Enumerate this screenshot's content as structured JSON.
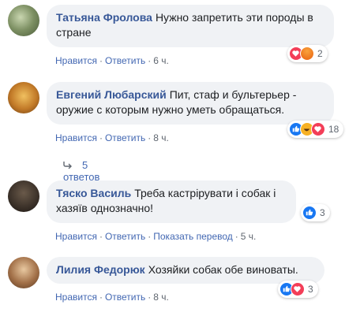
{
  "comments": [
    {
      "author": "Татьяна Фролова",
      "text": "Нужно запретить эти породы в стране",
      "actions": [
        "Нравится",
        "Ответить"
      ],
      "time": "6 ч.",
      "reactions": [
        "love-icon",
        "angry-icon"
      ],
      "reaction_count": "2"
    },
    {
      "author": "Евгений Любарский",
      "text": "Пит, стаф и бультерьер - оружие с которым нужно уметь обращаться.",
      "actions": [
        "Нравится",
        "Ответить"
      ],
      "time": "8 ч.",
      "reactions": [
        "like-icon",
        "haha-icon",
        "love-icon"
      ],
      "reaction_count": "18",
      "replies_label": "5 ответов"
    },
    {
      "author": "Тяско Василь",
      "text": "Треба кастрірувати і собак і хазяїв однозначно!",
      "actions": [
        "Нравится",
        "Ответить",
        "Показать перевод"
      ],
      "time": "5 ч.",
      "reactions": [
        "like-icon"
      ],
      "reaction_count": "3"
    },
    {
      "author": "Лилия Федорюк",
      "text": "Хозяйки собак обе виноваты.",
      "actions": [
        "Нравится",
        "Ответить"
      ],
      "time": "8 ч.",
      "reactions": [
        "like-icon",
        "love-icon"
      ],
      "reaction_count": "3"
    }
  ],
  "colors": {
    "like": "#1877f2",
    "love": "#f33e58",
    "angry": "#e9710f",
    "haha": "#f7b125",
    "link": "#385898",
    "bubble": "#f0f2f5"
  }
}
